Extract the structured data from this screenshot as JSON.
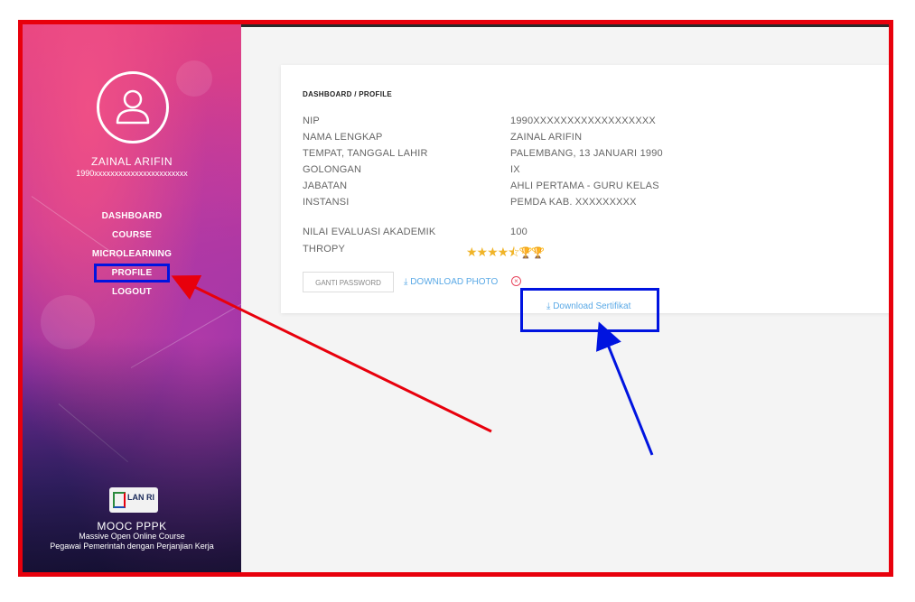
{
  "sidebar": {
    "user_name": "ZAINAL ARIFIN",
    "user_id": "1990xxxxxxxxxxxxxxxxxxxxxxx",
    "nav": [
      {
        "label": "DASHBOARD"
      },
      {
        "label": "COURSE"
      },
      {
        "label": "MICROLEARNING"
      },
      {
        "label": "PROFILE",
        "active": true
      },
      {
        "label": "LOGOUT"
      }
    ],
    "logo_text": "LAN RI",
    "footer_title": "MOOC PPPK",
    "footer_subtitle": "Massive Open Online Course",
    "footer_subtitle2": "Pegawai Pemerintah dengan Perjanjian Kerja"
  },
  "profile": {
    "breadcrumb": "DASHBOARD / PROFILE",
    "fields": [
      {
        "label": "NIP",
        "value": "1990XXXXXXXXXXXXXXXXXX"
      },
      {
        "label": "NAMA LENGKAP",
        "value": "ZAINAL ARIFIN"
      },
      {
        "label": "TEMPAT, TANGGAL LAHIR",
        "value": "PALEMBANG, 13 JANUARI 1990"
      },
      {
        "label": "GOLONGAN",
        "value": "IX"
      },
      {
        "label": "JABATAN",
        "value": "AHLI PERTAMA - GURU KELAS"
      },
      {
        "label": "INSTANSI",
        "value": "PEMDA KAB. XXXXXXXXX"
      }
    ],
    "score_label": "NILAI EVALUASI AKADEMIK",
    "score_value": "100",
    "trophy_label": "THROPY",
    "stars": "★★★★",
    "half_star": "⯪",
    "trophies": "🏆🏆",
    "rating": 4.5,
    "buttons": {
      "change_password": "GANTI PASSWORD",
      "download_photo": "⤓ DOWNLOAD PHOTO",
      "download_cert": "⤓ Download Sertifikat"
    }
  },
  "colors": {
    "highlight_red": "#e8000c",
    "highlight_blue": "#0014e0",
    "link_blue": "#5aa9e6"
  }
}
